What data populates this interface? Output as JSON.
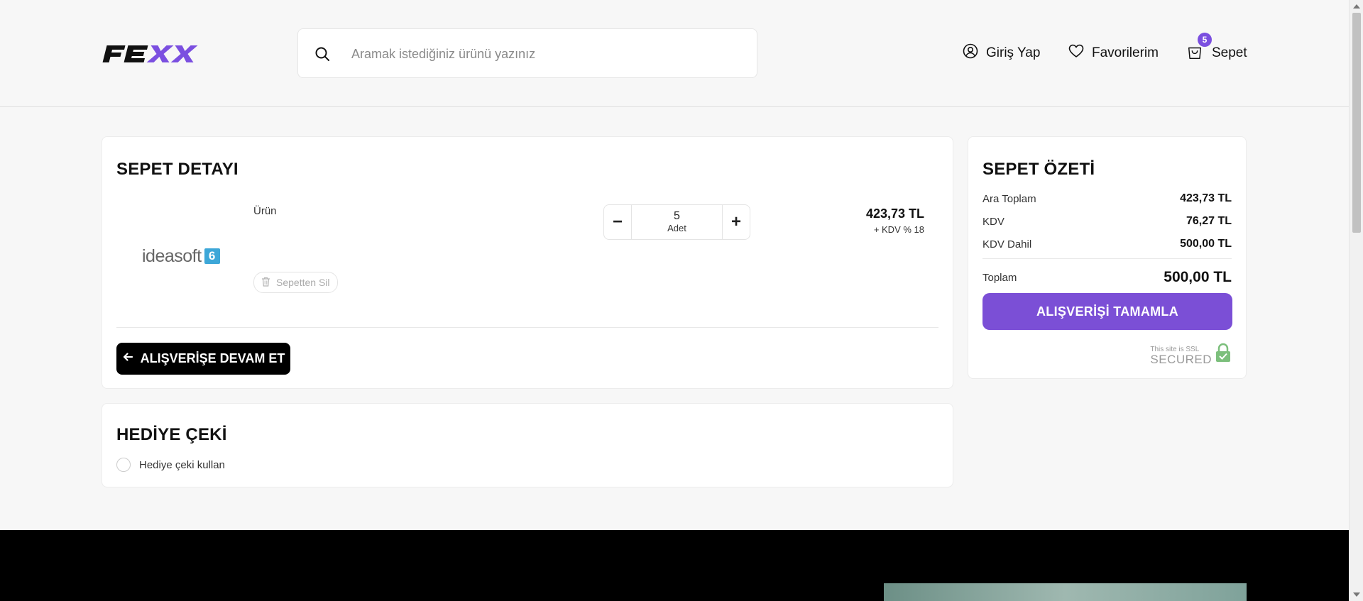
{
  "header": {
    "logo_text": "FEXX",
    "search": {
      "placeholder": "Aramak istediğiniz ürünü yazınız"
    },
    "nav": {
      "login_label": "Giriş Yap",
      "favorites_label": "Favorilerim",
      "cart_label": "Sepet",
      "cart_count": "5"
    }
  },
  "cart": {
    "title": "SEPET DETAYI",
    "item": {
      "image_brand": "ideasoft",
      "image_badge": "6",
      "name": "Ürün",
      "quantity": "5",
      "quantity_unit": "Adet",
      "decrease_symbol": "−",
      "increase_symbol": "+",
      "price": "423,73 TL",
      "vat_note": "+ KDV % 18",
      "remove_label": "Sepetten Sil"
    },
    "continue_label": "ALIŞVERİŞE DEVAM ET"
  },
  "gift": {
    "title": "HEDİYE ÇEKİ",
    "option_label": "Hediye çeki kullan"
  },
  "summary": {
    "title": "SEPET ÖZETİ",
    "rows": [
      {
        "label": "Ara Toplam",
        "value": "423,73 TL"
      },
      {
        "label": "KDV",
        "value": "76,27 TL"
      },
      {
        "label": "KDV Dahil",
        "value": "500,00 TL"
      }
    ],
    "total": {
      "label": "Toplam",
      "value": "500,00 TL"
    },
    "checkout_label": "ALIŞVERİŞİ TAMAMLA",
    "ssl_small": "This site is SSL",
    "ssl_big": "SECURED"
  },
  "colors": {
    "accent": "#7b4fd6",
    "badge": "#7b4fe0",
    "background": "#f7f7f7",
    "footer": "#000000"
  },
  "icons": {
    "search": "search-icon",
    "login": "user-circle-icon",
    "favorites": "heart-icon",
    "cart": "shopping-bag-icon",
    "remove": "trash-icon",
    "back": "arrow-left-icon",
    "ssl": "lock-icon"
  }
}
